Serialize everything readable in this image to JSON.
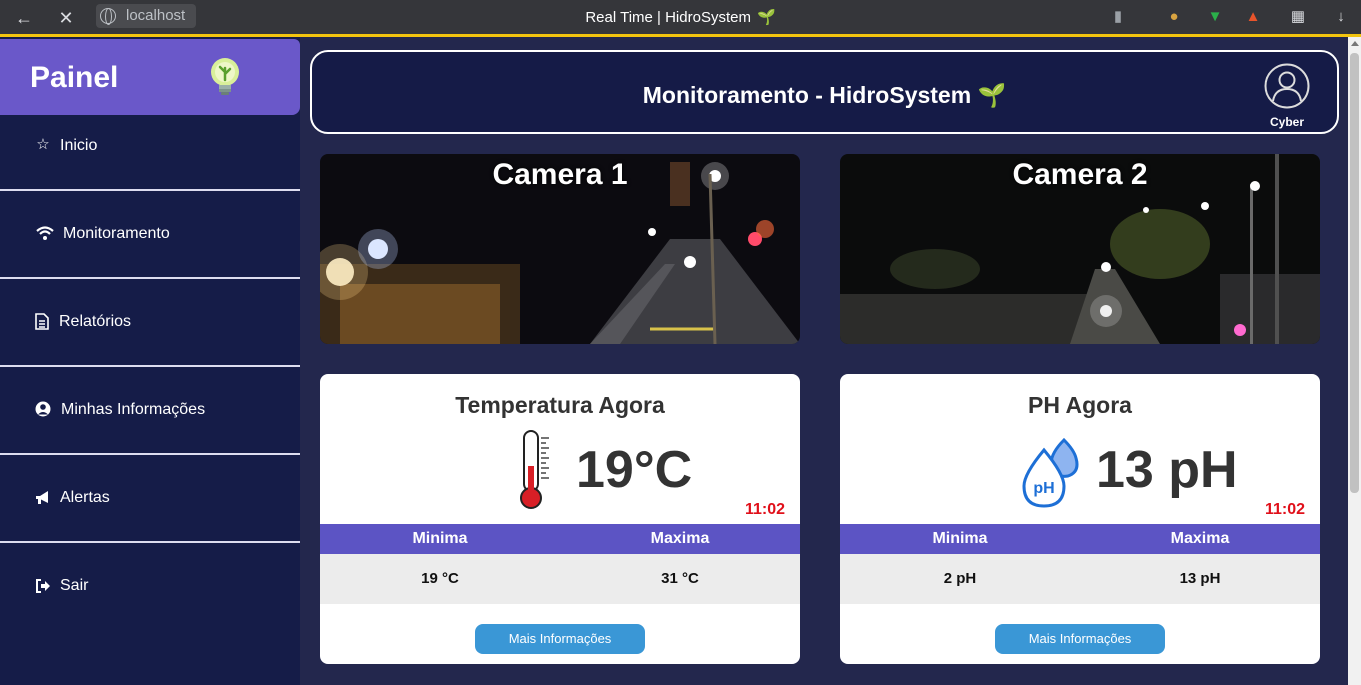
{
  "browser": {
    "url": "localhost",
    "tab_title": "Real Time | HidroSystem",
    "tab_emoji": "🌱"
  },
  "sidebar": {
    "brand": "Painel",
    "items": [
      {
        "label": "Inicio",
        "icon": "star-icon"
      },
      {
        "label": "Monitoramento",
        "icon": "wifi-icon"
      },
      {
        "label": "Relatórios",
        "icon": "document-icon"
      },
      {
        "label": "Minhas Informações",
        "icon": "user-circle-icon"
      },
      {
        "label": "Alertas",
        "icon": "megaphone-icon"
      },
      {
        "label": "Sair",
        "icon": "sign-out-icon"
      }
    ]
  },
  "header": {
    "title": "Monitoramento - HidroSystem",
    "emoji": "🌱",
    "user_name": "Cyber"
  },
  "cameras": [
    {
      "title": "Camera 1"
    },
    {
      "title": "Camera 2"
    }
  ],
  "cards": [
    {
      "title": "Temperatura Agora",
      "value": "19°C",
      "time": "11:02",
      "min_label": "Minima",
      "max_label": "Maxima",
      "min_value": "19 °C",
      "max_value": "31 °C",
      "button": "Mais Informações"
    },
    {
      "title": "PH Agora",
      "value": "13 pH",
      "time": "11:02",
      "min_label": "Minima",
      "max_label": "Maxima",
      "min_value": "2 pH",
      "max_value": "13 pH",
      "button": "Mais Informações",
      "icon_text": "pH"
    }
  ],
  "colors": {
    "sidebar": "#151c48",
    "brand": "#6a58c9",
    "main_bg": "#23274d",
    "table_head": "#5c54c4",
    "button": "#3a97d6",
    "time": "#e0101a"
  }
}
